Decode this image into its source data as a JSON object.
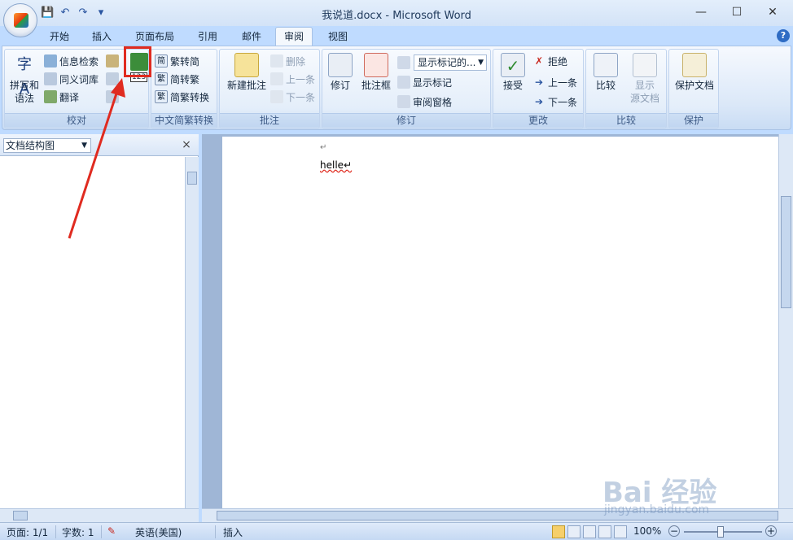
{
  "window": {
    "title": "我说道.docx - Microsoft Word",
    "min": "—",
    "max": "☐",
    "close": "✕"
  },
  "qat": {
    "save": "💾",
    "undo": "↶",
    "redo": "↷",
    "more": "▾"
  },
  "tabs": [
    "开始",
    "插入",
    "页面布局",
    "引用",
    "邮件",
    "审阅",
    "视图"
  ],
  "active_tab": "审阅",
  "ribbon": {
    "groups": {
      "proof": {
        "label": "校对",
        "spell": "拼写和\n语法",
        "research": "信息检索",
        "thesaurus": "同义词库",
        "translate": "翻译"
      },
      "convert": {
        "label": "中文简繁转换",
        "to_simp": "繁转简",
        "to_trad": "简转繁",
        "conv": "简繁转换"
      },
      "comments": {
        "label": "批注",
        "new": "新建批注",
        "delete": "删除",
        "prev": "上一条",
        "next": "下一条"
      },
      "tracking": {
        "label": "修订",
        "track": "修订",
        "balloons": "批注框",
        "markup_select": "显示标记的...",
        "show_markup": "显示标记",
        "review_pane": "审阅窗格"
      },
      "changes": {
        "label": "更改",
        "accept": "接受",
        "reject": "拒绝",
        "prev": "上一条",
        "next": "下一条"
      },
      "compare": {
        "label": "比较",
        "compare": "比较",
        "show_source": "显示\n源文档"
      },
      "protect": {
        "label": "保护",
        "protect_doc": "保护文档"
      }
    }
  },
  "nav_pane": {
    "selected": "文档结构图",
    "close": "×"
  },
  "document": {
    "mark": "↵",
    "text": "helle↵"
  },
  "status": {
    "page": "页面: 1/1",
    "words": "字数: 1",
    "lang": "英语(美国)",
    "mode": "插入",
    "zoom": "100%"
  },
  "watermark": {
    "logo": "Bai 经验",
    "url": "jingyan.baidu.com"
  },
  "colors": {
    "ribbon_bg": "#dbe8f8",
    "accent": "#e02b20"
  }
}
